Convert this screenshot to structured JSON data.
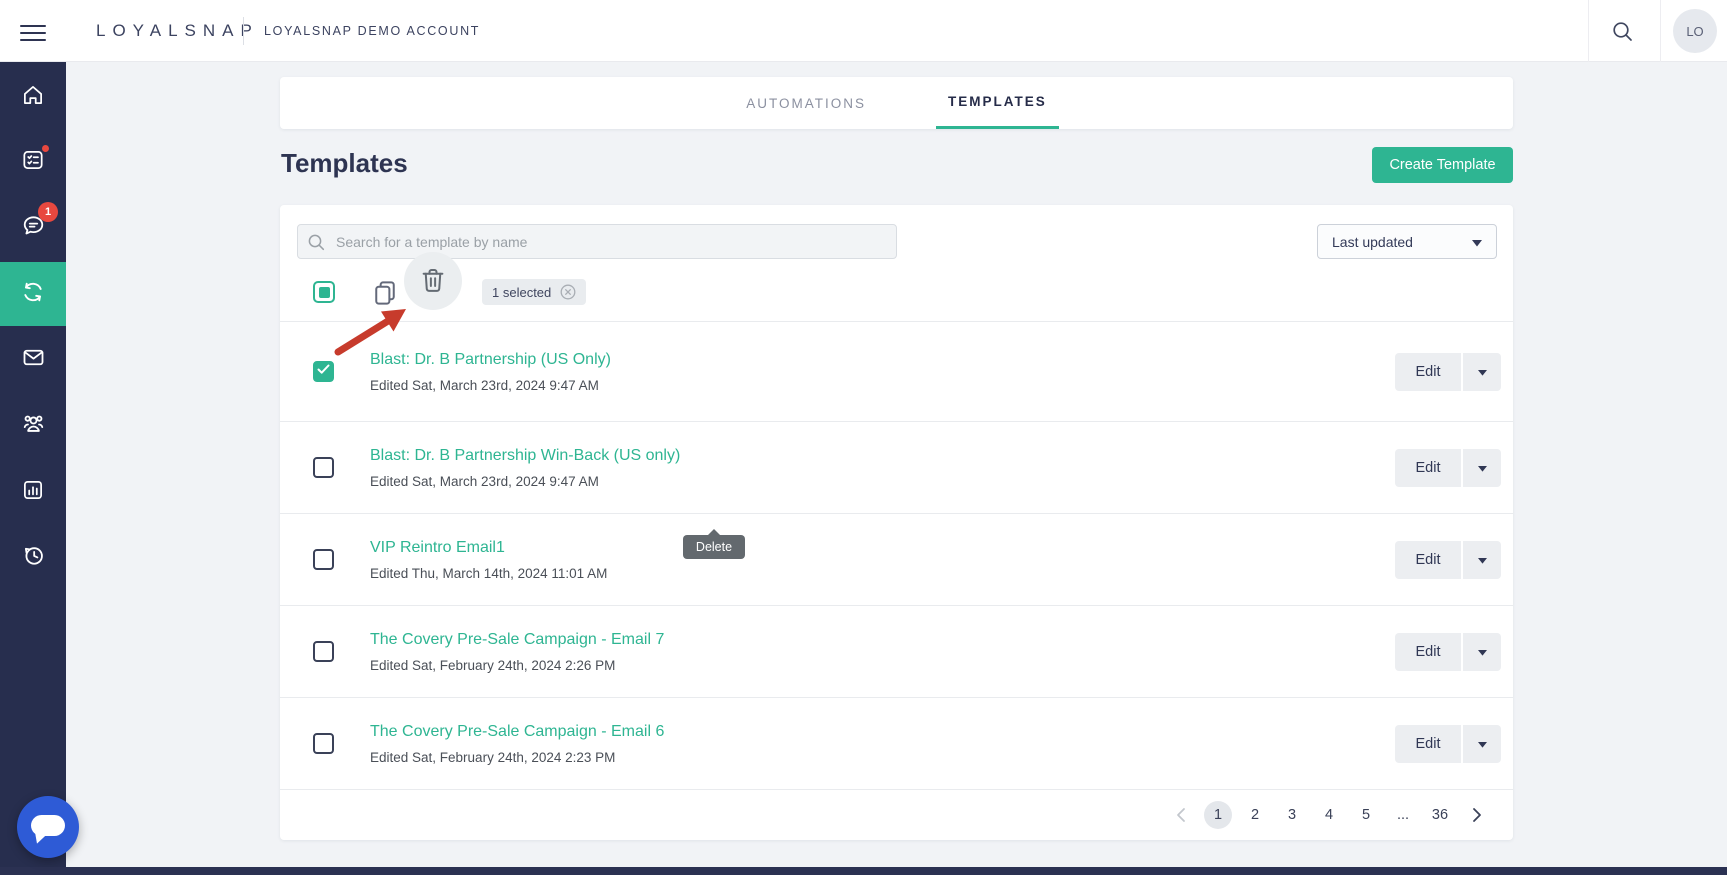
{
  "topbar": {
    "brand": "LOYALSNAP",
    "account": "LOYALSNAP DEMO ACCOUNT",
    "avatar_initials": "LO"
  },
  "sidebar": {
    "items": [
      {
        "id": "home",
        "icon": "home-icon"
      },
      {
        "id": "tasks",
        "icon": "checklist-icon",
        "badge_dot": true
      },
      {
        "id": "messages",
        "icon": "chat-icon",
        "badge": "1"
      },
      {
        "id": "automations",
        "icon": "sync-icon",
        "active": true
      },
      {
        "id": "email",
        "icon": "mail-icon"
      },
      {
        "id": "contacts",
        "icon": "people-icon"
      },
      {
        "id": "reports",
        "icon": "bar-chart-icon"
      },
      {
        "id": "history",
        "icon": "history-icon"
      }
    ]
  },
  "tabs": {
    "automations": "AUTOMATIONS",
    "templates": "TEMPLATES"
  },
  "page": {
    "title": "Templates",
    "create_button": "Create Template"
  },
  "toolbar": {
    "search_placeholder": "Search for a template by name",
    "sort_value": "Last updated",
    "selected_chip": "1 selected",
    "delete_tooltip": "Delete"
  },
  "rows": [
    {
      "title": "Blast: Dr. B Partnership (US Only)",
      "edited": "Edited Sat, March 23rd, 2024 9:47 AM",
      "checked": true,
      "edit_label": "Edit"
    },
    {
      "title": "Blast: Dr. B Partnership Win-Back (US only)",
      "edited": "Edited Sat, March 23rd, 2024 9:47 AM",
      "checked": false,
      "edit_label": "Edit"
    },
    {
      "title": "VIP Reintro Email1",
      "edited": "Edited Thu, March 14th, 2024 11:01 AM",
      "checked": false,
      "edit_label": "Edit"
    },
    {
      "title": "The Covery Pre-Sale Campaign - Email 7",
      "edited": "Edited Sat, February 24th, 2024 2:26 PM",
      "checked": false,
      "edit_label": "Edit"
    },
    {
      "title": "The Covery Pre-Sale Campaign - Email 6",
      "edited": "Edited Sat, February 24th, 2024 2:23 PM",
      "checked": false,
      "edit_label": "Edit"
    }
  ],
  "pagination": {
    "pages": [
      "1",
      "2",
      "3",
      "4",
      "5",
      "...",
      "36"
    ],
    "current": "1"
  },
  "colors": {
    "accent_green": "#2eb592",
    "navy": "#2e3452",
    "sidebar_bg": "#272e4e",
    "badge_red": "#e8483f",
    "arrow_red": "#c73b2c",
    "chat_blue": "#2e5bd6"
  }
}
